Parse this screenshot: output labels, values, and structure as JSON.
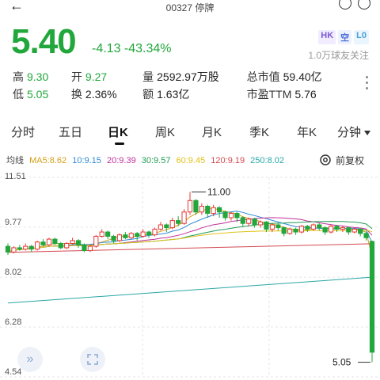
{
  "header": {
    "title": "00327 停牌"
  },
  "quote": {
    "price": "5.40",
    "change": "-4.13 -43.34%",
    "badges": [
      "HK",
      "空",
      "L0"
    ],
    "followers": "1.0万球友关注"
  },
  "stats": [
    [
      {
        "label": "高",
        "value": "9.30",
        "green": true
      },
      {
        "label": "开",
        "value": "9.27",
        "green": true
      },
      {
        "label": "量",
        "value": "2592.97万股",
        "green": false
      },
      {
        "label": "总市值",
        "value": "59.40亿",
        "green": false
      }
    ],
    [
      {
        "label": "低",
        "value": "5.05",
        "green": true
      },
      {
        "label": "换",
        "value": "2.36%",
        "green": false
      },
      {
        "label": "额",
        "value": "1.63亿",
        "green": false
      },
      {
        "label": "市盈TTM",
        "value": "5.76",
        "green": false
      }
    ]
  ],
  "tabs": [
    "分时",
    "五日",
    "日K",
    "周K",
    "月K",
    "季K",
    "年K",
    "分钟"
  ],
  "active_tab": "日K",
  "ma": {
    "label": "均线",
    "ma5": "MA5:8.62",
    "ma10": "10:9.15",
    "ma20": "20:9.39",
    "ma30": "30:9.57",
    "ma60": "60:9.45",
    "ma120": "120:9.19",
    "ma250": "250:8.02"
  },
  "fuquan": "前复权",
  "colors": {
    "down": "#21a73b",
    "up": "#e53935"
  },
  "chart_data": {
    "type": "candlestick",
    "y_ticks": [
      "11.51",
      "9.77",
      "8.02",
      "6.28",
      "4.54"
    ],
    "ylim": [
      4.54,
      11.51
    ],
    "high_label": "11.00",
    "low_label": "5.05",
    "candles": [
      [
        9.1,
        8.9,
        9.2,
        8.8
      ],
      [
        8.9,
        9.05,
        9.1,
        8.85
      ],
      [
        9.05,
        9.0,
        9.15,
        8.95
      ],
      [
        9.0,
        9.1,
        9.2,
        8.95
      ],
      [
        9.1,
        9.0,
        9.15,
        8.9
      ],
      [
        9.0,
        9.25,
        9.3,
        8.95
      ],
      [
        9.25,
        9.15,
        9.35,
        9.1
      ],
      [
        9.15,
        9.35,
        9.4,
        9.1
      ],
      [
        9.35,
        9.2,
        9.4,
        9.15
      ],
      [
        9.2,
        9.05,
        9.25,
        9.0
      ],
      [
        9.05,
        9.2,
        9.25,
        9.0
      ],
      [
        9.2,
        9.3,
        9.4,
        9.15
      ],
      [
        9.3,
        9.15,
        9.35,
        9.05
      ],
      [
        9.15,
        8.95,
        9.2,
        8.9
      ],
      [
        8.95,
        9.1,
        9.15,
        8.9
      ],
      [
        9.1,
        9.45,
        9.5,
        9.05
      ],
      [
        9.45,
        9.6,
        9.7,
        9.4
      ],
      [
        9.6,
        9.45,
        9.65,
        9.35
      ],
      [
        9.45,
        9.3,
        9.5,
        9.2
      ],
      [
        9.3,
        9.5,
        9.55,
        9.25
      ],
      [
        9.5,
        9.4,
        9.6,
        9.35
      ],
      [
        9.4,
        9.55,
        9.6,
        9.35
      ],
      [
        9.55,
        9.45,
        9.6,
        9.3
      ],
      [
        9.45,
        9.6,
        9.7,
        9.4
      ],
      [
        9.6,
        9.5,
        9.65,
        9.4
      ],
      [
        9.5,
        9.7,
        9.75,
        9.45
      ],
      [
        9.7,
        9.85,
        9.95,
        9.65
      ],
      [
        9.85,
        9.75,
        9.9,
        9.6
      ],
      [
        9.75,
        10.0,
        10.1,
        9.7
      ],
      [
        10.0,
        9.9,
        10.15,
        9.8
      ],
      [
        9.9,
        10.3,
        10.4,
        9.85
      ],
      [
        10.3,
        10.7,
        11.0,
        10.2
      ],
      [
        10.7,
        10.3,
        10.75,
        10.2
      ],
      [
        10.3,
        10.5,
        10.6,
        10.2
      ],
      [
        10.5,
        10.25,
        10.55,
        10.1
      ],
      [
        10.25,
        10.45,
        10.55,
        10.15
      ],
      [
        10.45,
        10.3,
        10.5,
        10.1
      ],
      [
        10.3,
        10.1,
        10.35,
        10.0
      ],
      [
        10.1,
        10.25,
        10.3,
        10.0
      ],
      [
        10.25,
        10.1,
        10.3,
        9.95
      ],
      [
        10.1,
        9.9,
        10.15,
        9.8
      ],
      [
        9.9,
        10.05,
        10.1,
        9.8
      ],
      [
        10.05,
        9.85,
        10.1,
        9.75
      ],
      [
        9.85,
        9.95,
        10.0,
        9.75
      ],
      [
        9.95,
        9.7,
        9.98,
        9.6
      ],
      [
        9.7,
        9.85,
        9.9,
        9.6
      ],
      [
        9.85,
        9.75,
        9.9,
        9.65
      ],
      [
        9.75,
        9.55,
        9.8,
        9.45
      ],
      [
        9.55,
        9.7,
        9.75,
        9.5
      ],
      [
        9.7,
        9.6,
        9.75,
        9.5
      ],
      [
        9.6,
        9.8,
        9.85,
        9.55
      ],
      [
        9.8,
        9.7,
        9.85,
        9.6
      ],
      [
        9.7,
        9.85,
        9.9,
        9.65
      ],
      [
        9.85,
        9.75,
        9.92,
        9.65
      ],
      [
        9.75,
        9.6,
        9.8,
        9.5
      ],
      [
        9.6,
        9.8,
        9.85,
        9.55
      ],
      [
        9.8,
        9.7,
        9.85,
        9.6
      ],
      [
        9.7,
        9.75,
        9.8,
        9.6
      ],
      [
        9.75,
        9.6,
        9.78,
        9.5
      ],
      [
        9.6,
        9.7,
        9.75,
        9.55
      ],
      [
        9.7,
        9.55,
        9.75,
        9.45
      ],
      [
        9.55,
        9.4,
        9.6,
        9.3
      ],
      [
        9.27,
        5.4,
        9.3,
        5.05
      ]
    ]
  }
}
